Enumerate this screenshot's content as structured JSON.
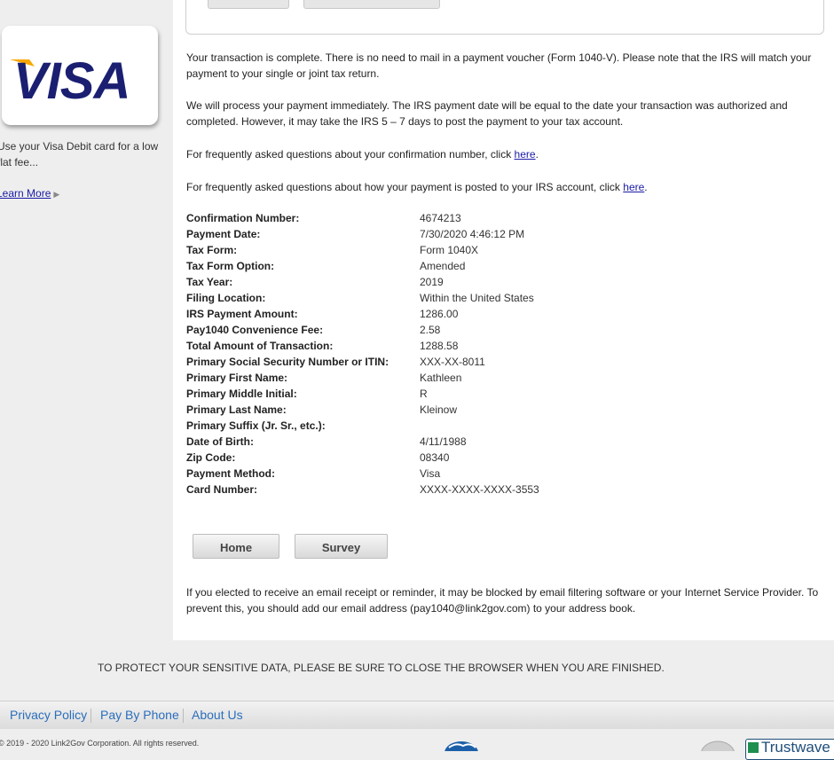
{
  "sidebar": {
    "visa_logo_text": "VISA",
    "promo_text": "Use your Visa Debit card for a low flat fee...",
    "learn_more": "Learn More"
  },
  "main": {
    "para1": "Your transaction is complete. There is no need to mail in a payment voucher (Form 1040-V). Please note that the IRS will match your payment to your single or joint tax return.",
    "para2": "We will process your payment immediately. The IRS payment date will be equal to the date your transaction was authorized and completed. However, it may take the IRS 5 – 7 days to post the payment to your tax account.",
    "faq1_text": "For frequently asked questions about your confirmation number, click ",
    "faq1_link": "here",
    "faq2_text": "For frequently asked questions about how your payment is posted to your IRS account, click ",
    "faq2_link": "here",
    "details": [
      {
        "label": "Confirmation Number:",
        "value": "4674213"
      },
      {
        "label": "Payment Date:",
        "value": "7/30/2020 4:46:12 PM"
      },
      {
        "label": "Tax Form:",
        "value": "Form 1040X"
      },
      {
        "label": "Tax Form Option:",
        "value": "Amended"
      },
      {
        "label": "Tax Year:",
        "value": "2019"
      },
      {
        "label": "Filing Location:",
        "value": "Within the United States"
      },
      {
        "label": "IRS Payment Amount:",
        "value": "1286.00"
      },
      {
        "label": "Pay1040 Convenience Fee:",
        "value": "2.58"
      },
      {
        "label": "Total Amount of Transaction:",
        "value": "1288.58"
      },
      {
        "label": "Primary Social Security Number or ITIN:",
        "value": "XXX-XX-8011"
      },
      {
        "label": "Primary First Name:",
        "value": "Kathleen"
      },
      {
        "label": "Primary Middle Initial:",
        "value": "R"
      },
      {
        "label": "Primary Last Name:",
        "value": "Kleinow"
      },
      {
        "label": "Primary Suffix (Jr. Sr., etc.):",
        "value": ""
      },
      {
        "label": "Date of Birth:",
        "value": "4/11/1988"
      },
      {
        "label": "Zip Code:",
        "value": "08340"
      },
      {
        "label": "Payment Method:",
        "value": "Visa"
      },
      {
        "label": "Card Number:",
        "value": "XXXX-XXXX-XXXX-3553"
      }
    ],
    "home_button": "Home",
    "survey_button": "Survey",
    "email_note": "If you elected to receive an email receipt or reminder, it may be blocked by email filtering software or your Internet Service Provider. To prevent this, you should add our email address (pay1040@link2gov.com) to your address book."
  },
  "protect_notice": "TO PROTECT YOUR SENSITIVE DATA, PLEASE BE SURE TO CLOSE THE BROWSER WHEN YOU ARE FINISHED.",
  "footer": {
    "links": [
      "Privacy Policy",
      "Pay By Phone",
      "About Us"
    ],
    "copyright": "© 2019 - 2020 Link2Gov Corporation. All rights reserved.",
    "trust_text": "Trustwave"
  },
  "colors": {
    "visa_blue": "#1a1f71",
    "visa_gold": "#f7a800",
    "link": "#1a1aa6",
    "footer_link": "#2a6ebb"
  }
}
